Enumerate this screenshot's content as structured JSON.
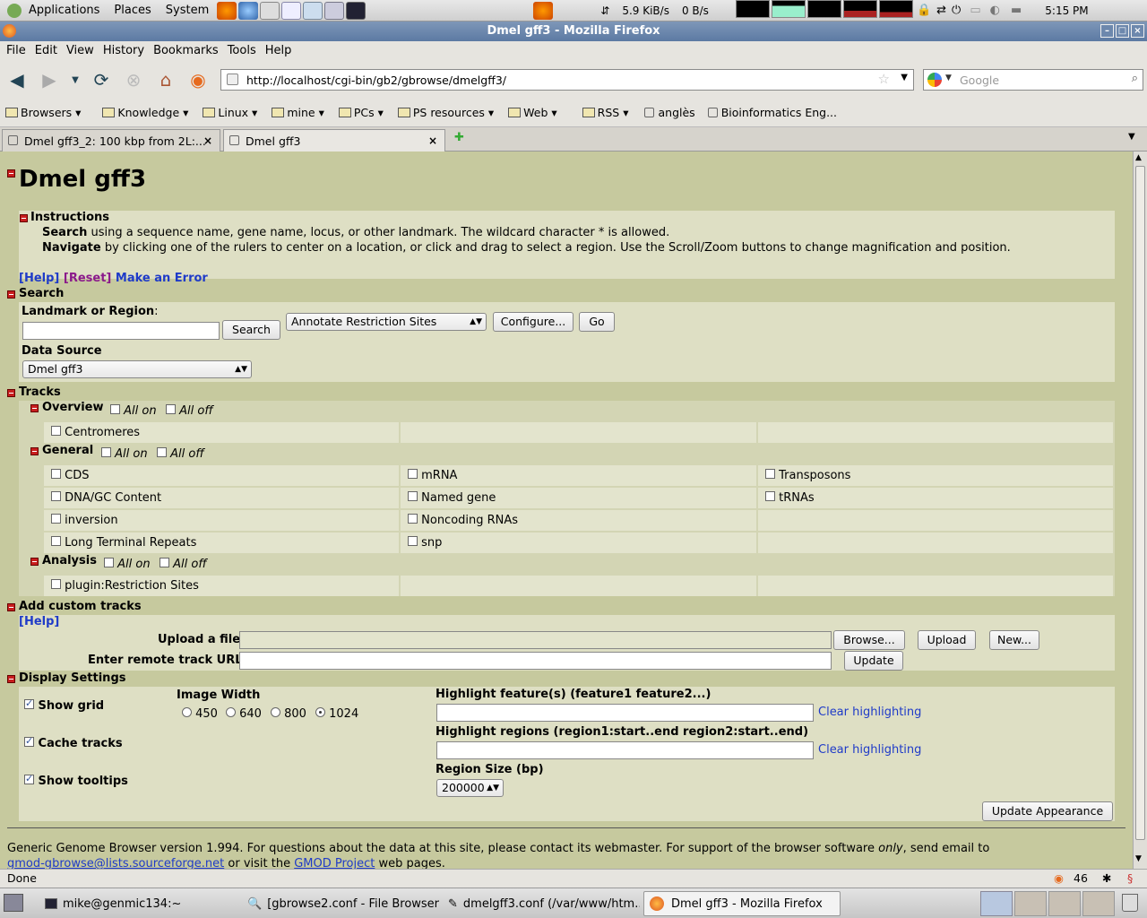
{
  "panel": {
    "menus": [
      "Applications",
      "Places",
      "System"
    ],
    "net_down": "5.9 KiB/s",
    "net_up": "0 B/s",
    "clock": "5:15 PM"
  },
  "window": {
    "title": "Dmel gff3 - Mozilla Firefox"
  },
  "menubar": [
    "File",
    "Edit",
    "View",
    "History",
    "Bookmarks",
    "Tools",
    "Help"
  ],
  "nav": {
    "url": "http://localhost/cgi-bin/gb2/gbrowse/dmelgff3/",
    "search_placeholder": "Google"
  },
  "bookmarks": [
    "Browsers",
    "Knowledge",
    "Linux",
    "mine",
    "PCs",
    "PS resources",
    "Web",
    "RSS",
    "anglès",
    "Bioinformatics Eng..."
  ],
  "tabs": [
    "Dmel gff3_2: 100 kbp from 2L:...",
    "Dmel gff3"
  ],
  "page": {
    "title": "Dmel gff3",
    "instructions_header": "Instructions",
    "search_word": "Search",
    "search_text": " using a sequence name, gene name, locus, or other landmark. The wildcard character * is allowed.",
    "navigate_word": "Navigate",
    "navigate_text": " by clicking one of the rulers to center on a location, or click and drag to select a region. Use the Scroll/Zoom buttons to change magnification and position.",
    "help": "[Help]",
    "reset": "[Reset]",
    "error": "Make an Error",
    "search_section": "Search",
    "landmark_label": "Landmark or Region",
    "search_button": "Search",
    "plugin_select": "Annotate Restriction Sites",
    "configure_button": "Configure...",
    "go_button": "Go",
    "datasource_label": "Data Source",
    "datasource_select": "Dmel gff3",
    "tracks_section": "Tracks",
    "all_on": "All on",
    "all_off": "All off",
    "groups": {
      "overview": {
        "name": "Overview",
        "tracks": [
          "Centromeres"
        ]
      },
      "general": {
        "name": "General",
        "tracks": [
          "CDS",
          "mRNA",
          "Transposons",
          "DNA/GC Content",
          "Named gene",
          "tRNAs",
          "inversion",
          "Noncoding RNAs",
          "Long Terminal Repeats",
          "snp"
        ]
      },
      "analysis": {
        "name": "Analysis",
        "tracks": [
          "plugin:Restriction Sites"
        ]
      }
    },
    "custom_section": "Add custom tracks",
    "custom_help": "[Help]",
    "upload_label": "Upload a file",
    "browse_button": "Browse...",
    "upload_button": "Upload",
    "new_button": "New...",
    "remote_label": "Enter remote track URL",
    "update_button": "Update",
    "display_section": "Display Settings",
    "show_grid": "Show grid",
    "cache_tracks": "Cache tracks",
    "show_tooltips": "Show tooltips",
    "image_width_label": "Image Width",
    "widths": [
      "450",
      "640",
      "800",
      "1024"
    ],
    "highlight_features_label": "Highlight feature(s) (feature1 feature2...)",
    "highlight_regions_label": "Highlight regions (region1:start..end region2:start..end)",
    "clear_highlighting": "Clear highlighting",
    "region_size_label": "Region Size (bp)",
    "region_size": "200000",
    "update_appearance": "Update Appearance",
    "footer1": "Generic Genome Browser version 1.994. For questions about the data at this site, please contact its webmaster. For support of the browser software ",
    "footer_only": "only",
    "footer2": ", send email to",
    "footer_email": "gmod-gbrowse@lists.sourceforge.net",
    "footer3": " or visit the ",
    "footer_gmod": "GMOD Project",
    "footer4": " web pages."
  },
  "status": {
    "text": "Done",
    "count": "46"
  },
  "taskbar": [
    "mike@genmic134:~",
    "[gbrowse2.conf - File Browser]",
    "dmelgff3.conf (/var/www/htm...",
    "Dmel gff3 - Mozilla Firefox"
  ]
}
